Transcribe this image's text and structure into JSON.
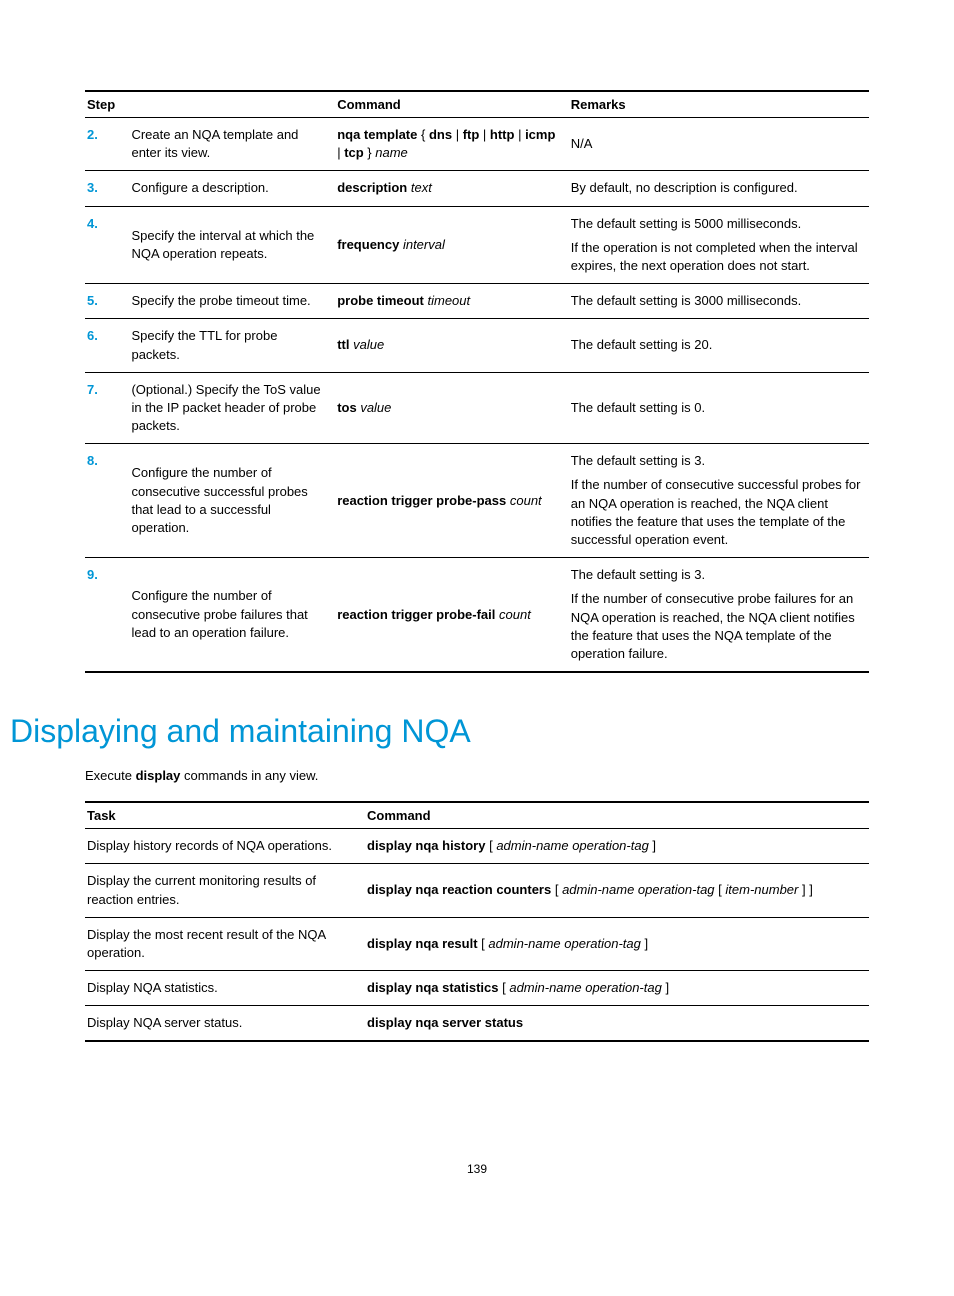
{
  "table1": {
    "headers": {
      "step": "Step",
      "command": "Command",
      "remarks": "Remarks"
    },
    "rows": [
      {
        "num": "2.",
        "step": "Create an NQA template and enter its view.",
        "cmd": "<b>nqa template</b> { <b>dns</b> | <b>ftp</b> | <b>http</b> | <b>icmp</b> | <b>tcp</b> } <i>name</i>",
        "remarks": [
          "N/A"
        ]
      },
      {
        "num": "3.",
        "step": "Configure a description.",
        "cmd": "<b>description</b> <i>text</i>",
        "remarks": [
          "By default, no description is configured."
        ]
      },
      {
        "num": "4.",
        "step": "Specify the interval at which the NQA operation repeats.",
        "cmd": "<b>frequency</b> <i>interval</i>",
        "remarks": [
          "The default setting is 5000 milliseconds.",
          "If the operation is not completed when the interval expires, the next operation does not start."
        ]
      },
      {
        "num": "5.",
        "step": "Specify the probe timeout time.",
        "cmd": "<b>probe timeout</b> <i>timeout</i>",
        "remarks": [
          "The default setting is 3000 milliseconds."
        ]
      },
      {
        "num": "6.",
        "step": "Specify the TTL for probe packets.",
        "cmd": "<b>ttl</b> <i>value</i>",
        "remarks": [
          "The default setting is 20."
        ]
      },
      {
        "num": "7.",
        "step": "(Optional.) Specify the ToS value in the IP packet header of probe packets.",
        "cmd": "<b>tos</b> <i>value</i>",
        "remarks": [
          "The default setting is 0."
        ]
      },
      {
        "num": "8.",
        "step": "Configure the number of consecutive successful probes that lead to a successful operation.",
        "cmd": "<b>reaction trigger probe-pass</b> <i>count</i>",
        "remarks": [
          "The default setting is 3.",
          "If the number of consecutive successful probes for an NQA operation is reached, the NQA client notifies the feature that uses the template of the successful operation event."
        ]
      },
      {
        "num": "9.",
        "step": "Configure the number of consecutive probe failures that lead to an operation failure.",
        "cmd": "<b>reaction trigger probe-fail</b> <i>count</i>",
        "remarks": [
          "The default setting is 3.",
          "If the number of consecutive probe failures for an NQA operation is reached, the NQA client notifies the feature that uses the NQA template of the operation failure."
        ]
      }
    ]
  },
  "sectionTitle": "Displaying and maintaining NQA",
  "intro": "Execute <b>display</b> commands in any view.",
  "table2": {
    "headers": {
      "task": "Task",
      "command": "Command"
    },
    "rows": [
      {
        "task": "Display history records of NQA operations.",
        "cmd": "<b>display nqa history</b> [ <i>admin-name operation-tag</i> ]"
      },
      {
        "task": "Display the current monitoring results of reaction entries.",
        "cmd": "<b>display nqa reaction counters</b> [ <i>admin-name operation-tag</i> [ <i>item-number</i> ] ]"
      },
      {
        "task": "Display the most recent result of the NQA operation.",
        "cmd": "<b>display nqa result</b> [ <i>admin-name operation-tag</i> ]"
      },
      {
        "task": "Display NQA statistics.",
        "cmd": "<b>display nqa statistics</b> [ <i>admin-name operation-tag</i> ]"
      },
      {
        "task": "Display NQA server status.",
        "cmd": "<b>display nqa server status</b>"
      }
    ]
  },
  "pageNumber": "139"
}
